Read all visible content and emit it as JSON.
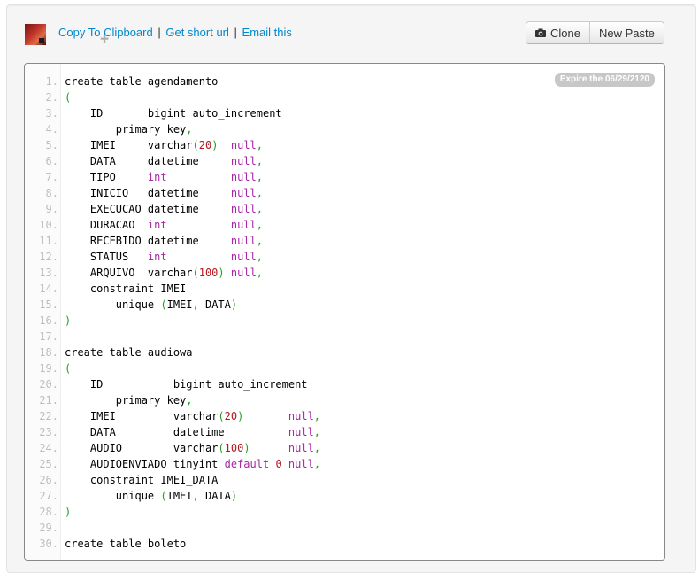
{
  "links": {
    "copy": "Copy To Clipboard",
    "short_url": "Get short url",
    "email": "Email this",
    "sep": "|"
  },
  "buttons": {
    "clone": "Clone",
    "new_paste": "New Paste"
  },
  "expire_badge": "Expire the 06/29/2120",
  "icons": {
    "avatar": "user-avatar",
    "camera": "camera-icon",
    "puzzle": "puzzle-icon"
  },
  "code_lines": [
    [
      [
        "k",
        "create table agendamento"
      ]
    ],
    [
      [
        "p",
        "("
      ]
    ],
    [
      [
        "k",
        "    ID       bigint auto_increment"
      ]
    ],
    [
      [
        "k",
        "        primary key"
      ],
      [
        "p",
        ","
      ]
    ],
    [
      [
        "k",
        "    IMEI     varchar"
      ],
      [
        "p",
        "("
      ],
      [
        "num",
        "20"
      ],
      [
        "p",
        ")"
      ],
      [
        "k",
        "  "
      ],
      [
        "n",
        "null"
      ],
      [
        "p",
        ","
      ]
    ],
    [
      [
        "k",
        "    DATA     datetime     "
      ],
      [
        "n",
        "null"
      ],
      [
        "p",
        ","
      ]
    ],
    [
      [
        "k",
        "    TIPO     "
      ],
      [
        "t",
        "int"
      ],
      [
        "k",
        "          "
      ],
      [
        "n",
        "null"
      ],
      [
        "p",
        ","
      ]
    ],
    [
      [
        "k",
        "    INICIO   datetime     "
      ],
      [
        "n",
        "null"
      ],
      [
        "p",
        ","
      ]
    ],
    [
      [
        "k",
        "    EXECUCAO datetime     "
      ],
      [
        "n",
        "null"
      ],
      [
        "p",
        ","
      ]
    ],
    [
      [
        "k",
        "    DURACAO  "
      ],
      [
        "t",
        "int"
      ],
      [
        "k",
        "          "
      ],
      [
        "n",
        "null"
      ],
      [
        "p",
        ","
      ]
    ],
    [
      [
        "k",
        "    RECEBIDO datetime     "
      ],
      [
        "n",
        "null"
      ],
      [
        "p",
        ","
      ]
    ],
    [
      [
        "k",
        "    STATUS   "
      ],
      [
        "t",
        "int"
      ],
      [
        "k",
        "          "
      ],
      [
        "n",
        "null"
      ],
      [
        "p",
        ","
      ]
    ],
    [
      [
        "k",
        "    ARQUIVO  varchar"
      ],
      [
        "p",
        "("
      ],
      [
        "num",
        "100"
      ],
      [
        "p",
        ")"
      ],
      [
        "k",
        " "
      ],
      [
        "n",
        "null"
      ],
      [
        "p",
        ","
      ]
    ],
    [
      [
        "k",
        "    constraint IMEI"
      ]
    ],
    [
      [
        "k",
        "        unique "
      ],
      [
        "p",
        "("
      ],
      [
        "k",
        "IMEI"
      ],
      [
        "p",
        ","
      ],
      [
        "k",
        " DATA"
      ],
      [
        "p",
        ")"
      ]
    ],
    [
      [
        "p",
        ")"
      ]
    ],
    [],
    [
      [
        "k",
        "create table audiowa"
      ]
    ],
    [
      [
        "p",
        "("
      ]
    ],
    [
      [
        "k",
        "    ID           bigint auto_increment"
      ]
    ],
    [
      [
        "k",
        "        primary key"
      ],
      [
        "p",
        ","
      ]
    ],
    [
      [
        "k",
        "    IMEI         varchar"
      ],
      [
        "p",
        "("
      ],
      [
        "num",
        "20"
      ],
      [
        "p",
        ")"
      ],
      [
        "k",
        "       "
      ],
      [
        "n",
        "null"
      ],
      [
        "p",
        ","
      ]
    ],
    [
      [
        "k",
        "    DATA         datetime          "
      ],
      [
        "n",
        "null"
      ],
      [
        "p",
        ","
      ]
    ],
    [
      [
        "k",
        "    AUDIO        varchar"
      ],
      [
        "p",
        "("
      ],
      [
        "num",
        "100"
      ],
      [
        "p",
        ")"
      ],
      [
        "k",
        "      "
      ],
      [
        "n",
        "null"
      ],
      [
        "p",
        ","
      ]
    ],
    [
      [
        "k",
        "    AUDIOENVIADO tinyint "
      ],
      [
        "t",
        "default"
      ],
      [
        "k",
        " "
      ],
      [
        "num",
        "0"
      ],
      [
        "k",
        " "
      ],
      [
        "n",
        "null"
      ],
      [
        "p",
        ","
      ]
    ],
    [
      [
        "k",
        "    constraint IMEI_DATA"
      ]
    ],
    [
      [
        "k",
        "        unique "
      ],
      [
        "p",
        "("
      ],
      [
        "k",
        "IMEI"
      ],
      [
        "p",
        ","
      ],
      [
        "k",
        " DATA"
      ],
      [
        "p",
        ")"
      ]
    ],
    [
      [
        "p",
        ")"
      ]
    ],
    [],
    [
      [
        "k",
        "create table boleto"
      ]
    ]
  ]
}
